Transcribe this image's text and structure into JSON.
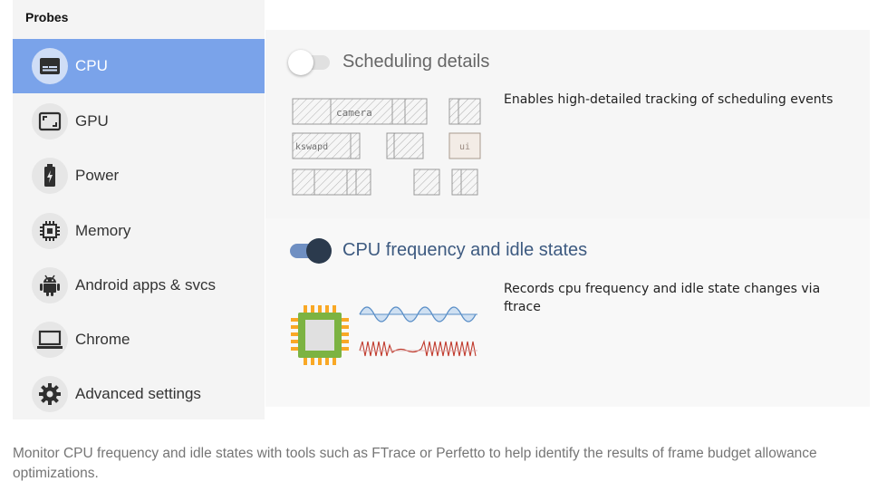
{
  "sidebar": {
    "title": "Probes",
    "items": [
      {
        "label": "CPU",
        "icon": "cpu-icon",
        "active": true
      },
      {
        "label": "GPU",
        "icon": "gpu-icon",
        "active": false
      },
      {
        "label": "Power",
        "icon": "battery-icon",
        "active": false
      },
      {
        "label": "Memory",
        "icon": "memory-chip-icon",
        "active": false
      },
      {
        "label": "Android apps & svcs",
        "icon": "android-icon",
        "active": false
      },
      {
        "label": "Chrome",
        "icon": "laptop-icon",
        "active": false
      },
      {
        "label": "Advanced settings",
        "icon": "gear-icon",
        "active": false
      }
    ]
  },
  "probes": [
    {
      "title": "Scheduling details",
      "enabled": false,
      "description": "Enables high-detailed tracking of scheduling events",
      "illustration_labels": [
        "camera",
        "kswapd",
        "ui"
      ]
    },
    {
      "title": "CPU frequency and idle states",
      "enabled": true,
      "description": "Records cpu frequency and idle state changes via ftrace"
    }
  ],
  "caption": "Monitor CPU frequency and idle states with tools such as FTrace or Perfetto to help identify the results of frame budget allowance optimizations.",
  "colors": {
    "active_nav": "#7aa3ea",
    "accent": "#3d5a80",
    "toggle_on_track": "#6f8fc2",
    "toggle_on_knob": "#2b3a4d",
    "toggle_off": "#e0e0e0",
    "chip_fill": "#7cb342",
    "chip_pins": "#f9a825",
    "wave_blue": "#5b8fc7",
    "wave_red": "#c0392b"
  }
}
